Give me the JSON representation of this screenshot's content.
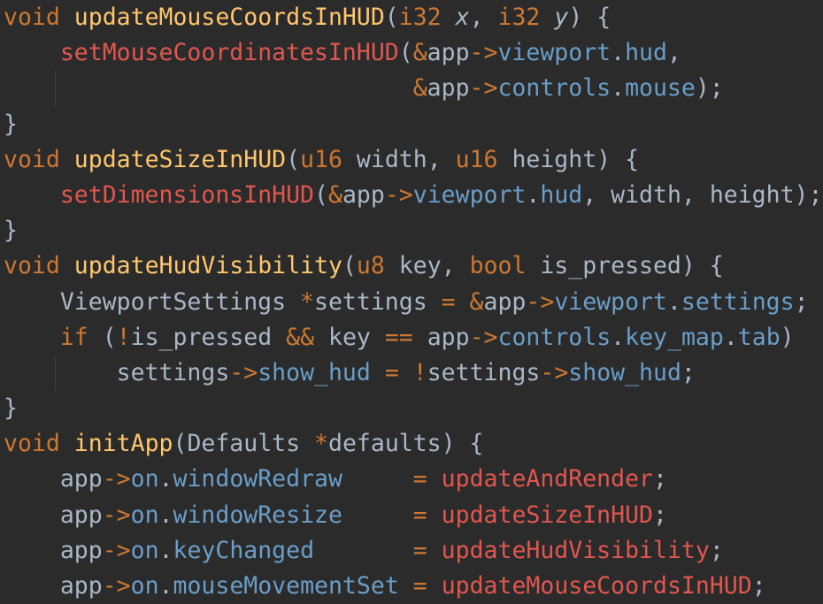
{
  "colors": {
    "background": "#2b2b2b",
    "default": "#a9b7c6",
    "keyword": "#cc7832",
    "function_decl": "#ffc66d",
    "function_call": "#e0574f",
    "field": "#6a9ec8",
    "indent_guide": "#3b3b3b"
  },
  "lines": [
    {
      "guide": false,
      "tokens": [
        {
          "t": "void",
          "c": "kw"
        },
        {
          "t": " ",
          "c": "punct"
        },
        {
          "t": "updateMouseCoordsInHUD",
          "c": "fn"
        },
        {
          "t": "(",
          "c": "punct"
        },
        {
          "t": "i32",
          "c": "kw"
        },
        {
          "t": " ",
          "c": "punct"
        },
        {
          "t": "x",
          "c": "param ital"
        },
        {
          "t": ", ",
          "c": "punct"
        },
        {
          "t": "i32",
          "c": "kw"
        },
        {
          "t": " ",
          "c": "punct"
        },
        {
          "t": "y",
          "c": "param ital"
        },
        {
          "t": ") {",
          "c": "punct"
        }
      ]
    },
    {
      "guide": false,
      "tokens": [
        {
          "t": "    ",
          "c": "punct"
        },
        {
          "t": "setMouseCoordinatesInHUD",
          "c": "call"
        },
        {
          "t": "(",
          "c": "punct"
        },
        {
          "t": "&",
          "c": "kw"
        },
        {
          "t": "app",
          "c": "punct"
        },
        {
          "t": "->",
          "c": "kw"
        },
        {
          "t": "viewport",
          "c": "fld"
        },
        {
          "t": ".",
          "c": "punct"
        },
        {
          "t": "hud",
          "c": "fld"
        },
        {
          "t": ",",
          "c": "punct"
        }
      ]
    },
    {
      "guide": true,
      "tokens": [
        {
          "t": "                             ",
          "c": "punct"
        },
        {
          "t": "&",
          "c": "kw"
        },
        {
          "t": "app",
          "c": "punct"
        },
        {
          "t": "->",
          "c": "kw"
        },
        {
          "t": "controls",
          "c": "fld"
        },
        {
          "t": ".",
          "c": "punct"
        },
        {
          "t": "mouse",
          "c": "fld"
        },
        {
          "t": ");",
          "c": "punct"
        }
      ]
    },
    {
      "guide": false,
      "tokens": [
        {
          "t": "}",
          "c": "punct"
        }
      ]
    },
    {
      "guide": false,
      "tokens": [
        {
          "t": "void",
          "c": "kw"
        },
        {
          "t": " ",
          "c": "punct"
        },
        {
          "t": "updateSizeInHUD",
          "c": "fn"
        },
        {
          "t": "(",
          "c": "punct"
        },
        {
          "t": "u16",
          "c": "kw"
        },
        {
          "t": " width, ",
          "c": "punct"
        },
        {
          "t": "u16",
          "c": "kw"
        },
        {
          "t": " height) {",
          "c": "punct"
        }
      ]
    },
    {
      "guide": false,
      "tokens": [
        {
          "t": "    ",
          "c": "punct"
        },
        {
          "t": "setDimensionsInHUD",
          "c": "call"
        },
        {
          "t": "(",
          "c": "punct"
        },
        {
          "t": "&",
          "c": "kw"
        },
        {
          "t": "app",
          "c": "punct"
        },
        {
          "t": "->",
          "c": "kw"
        },
        {
          "t": "viewport",
          "c": "fld"
        },
        {
          "t": ".",
          "c": "punct"
        },
        {
          "t": "hud",
          "c": "fld"
        },
        {
          "t": ", width, height);",
          "c": "punct"
        }
      ]
    },
    {
      "guide": false,
      "tokens": [
        {
          "t": "}",
          "c": "punct"
        }
      ]
    },
    {
      "guide": false,
      "tokens": [
        {
          "t": "void",
          "c": "kw"
        },
        {
          "t": " ",
          "c": "punct"
        },
        {
          "t": "updateHudVisibility",
          "c": "fn"
        },
        {
          "t": "(",
          "c": "punct"
        },
        {
          "t": "u8",
          "c": "kw"
        },
        {
          "t": " key, ",
          "c": "punct"
        },
        {
          "t": "bool",
          "c": "kw"
        },
        {
          "t": " is_pressed) {",
          "c": "punct"
        }
      ]
    },
    {
      "guide": false,
      "tokens": [
        {
          "t": "    ViewportSettings ",
          "c": "punct"
        },
        {
          "t": "*",
          "c": "kw"
        },
        {
          "t": "settings ",
          "c": "punct"
        },
        {
          "t": "=",
          "c": "kw"
        },
        {
          "t": " ",
          "c": "punct"
        },
        {
          "t": "&",
          "c": "kw"
        },
        {
          "t": "app",
          "c": "punct"
        },
        {
          "t": "->",
          "c": "kw"
        },
        {
          "t": "viewport",
          "c": "fld"
        },
        {
          "t": ".",
          "c": "punct"
        },
        {
          "t": "settings",
          "c": "fld"
        },
        {
          "t": ";",
          "c": "punct"
        }
      ]
    },
    {
      "guide": false,
      "tokens": [
        {
          "t": "    ",
          "c": "punct"
        },
        {
          "t": "if",
          "c": "kw"
        },
        {
          "t": " (",
          "c": "punct"
        },
        {
          "t": "!",
          "c": "kw"
        },
        {
          "t": "is_pressed ",
          "c": "punct"
        },
        {
          "t": "&&",
          "c": "kw"
        },
        {
          "t": " key ",
          "c": "punct"
        },
        {
          "t": "==",
          "c": "kw"
        },
        {
          "t": " app",
          "c": "punct"
        },
        {
          "t": "->",
          "c": "kw"
        },
        {
          "t": "controls",
          "c": "fld"
        },
        {
          "t": ".",
          "c": "punct"
        },
        {
          "t": "key_map",
          "c": "fld"
        },
        {
          "t": ".",
          "c": "punct"
        },
        {
          "t": "tab",
          "c": "fld"
        },
        {
          "t": ")",
          "c": "punct"
        }
      ]
    },
    {
      "guide": true,
      "tokens": [
        {
          "t": "        settings",
          "c": "punct"
        },
        {
          "t": "->",
          "c": "kw"
        },
        {
          "t": "show_hud",
          "c": "fld"
        },
        {
          "t": " ",
          "c": "punct"
        },
        {
          "t": "=",
          "c": "kw"
        },
        {
          "t": " ",
          "c": "punct"
        },
        {
          "t": "!",
          "c": "kw"
        },
        {
          "t": "settings",
          "c": "punct"
        },
        {
          "t": "->",
          "c": "kw"
        },
        {
          "t": "show_hud",
          "c": "fld"
        },
        {
          "t": ";",
          "c": "punct"
        }
      ]
    },
    {
      "guide": false,
      "tokens": [
        {
          "t": "}",
          "c": "punct"
        }
      ]
    },
    {
      "guide": false,
      "tokens": [
        {
          "t": "void",
          "c": "kw"
        },
        {
          "t": " ",
          "c": "punct"
        },
        {
          "t": "initApp",
          "c": "fn"
        },
        {
          "t": "(Defaults ",
          "c": "punct"
        },
        {
          "t": "*",
          "c": "kw"
        },
        {
          "t": "defaults) {",
          "c": "punct"
        }
      ]
    },
    {
      "guide": false,
      "tokens": [
        {
          "t": "    app",
          "c": "punct"
        },
        {
          "t": "->",
          "c": "kw"
        },
        {
          "t": "on",
          "c": "fld"
        },
        {
          "t": ".",
          "c": "punct"
        },
        {
          "t": "windowRedraw",
          "c": "fld"
        },
        {
          "t": "     ",
          "c": "punct"
        },
        {
          "t": "=",
          "c": "kw"
        },
        {
          "t": " ",
          "c": "punct"
        },
        {
          "t": "updateAndRender",
          "c": "call"
        },
        {
          "t": ";",
          "c": "punct"
        }
      ]
    },
    {
      "guide": false,
      "tokens": [
        {
          "t": "    app",
          "c": "punct"
        },
        {
          "t": "->",
          "c": "kw"
        },
        {
          "t": "on",
          "c": "fld"
        },
        {
          "t": ".",
          "c": "punct"
        },
        {
          "t": "windowResize",
          "c": "fld"
        },
        {
          "t": "     ",
          "c": "punct"
        },
        {
          "t": "=",
          "c": "kw"
        },
        {
          "t": " ",
          "c": "punct"
        },
        {
          "t": "updateSizeInHUD",
          "c": "call"
        },
        {
          "t": ";",
          "c": "punct"
        }
      ]
    },
    {
      "guide": false,
      "tokens": [
        {
          "t": "    app",
          "c": "punct"
        },
        {
          "t": "->",
          "c": "kw"
        },
        {
          "t": "on",
          "c": "fld"
        },
        {
          "t": ".",
          "c": "punct"
        },
        {
          "t": "keyChanged",
          "c": "fld"
        },
        {
          "t": "       ",
          "c": "punct"
        },
        {
          "t": "=",
          "c": "kw"
        },
        {
          "t": " ",
          "c": "punct"
        },
        {
          "t": "updateHudVisibility",
          "c": "call"
        },
        {
          "t": ";",
          "c": "punct"
        }
      ]
    },
    {
      "guide": false,
      "tokens": [
        {
          "t": "    app",
          "c": "punct"
        },
        {
          "t": "->",
          "c": "kw"
        },
        {
          "t": "on",
          "c": "fld"
        },
        {
          "t": ".",
          "c": "punct"
        },
        {
          "t": "mouseMovementSet",
          "c": "fld"
        },
        {
          "t": " ",
          "c": "punct"
        },
        {
          "t": "=",
          "c": "kw"
        },
        {
          "t": " ",
          "c": "punct"
        },
        {
          "t": "updateMouseCoordsInHUD",
          "c": "call"
        },
        {
          "t": ";",
          "c": "punct"
        }
      ]
    }
  ]
}
